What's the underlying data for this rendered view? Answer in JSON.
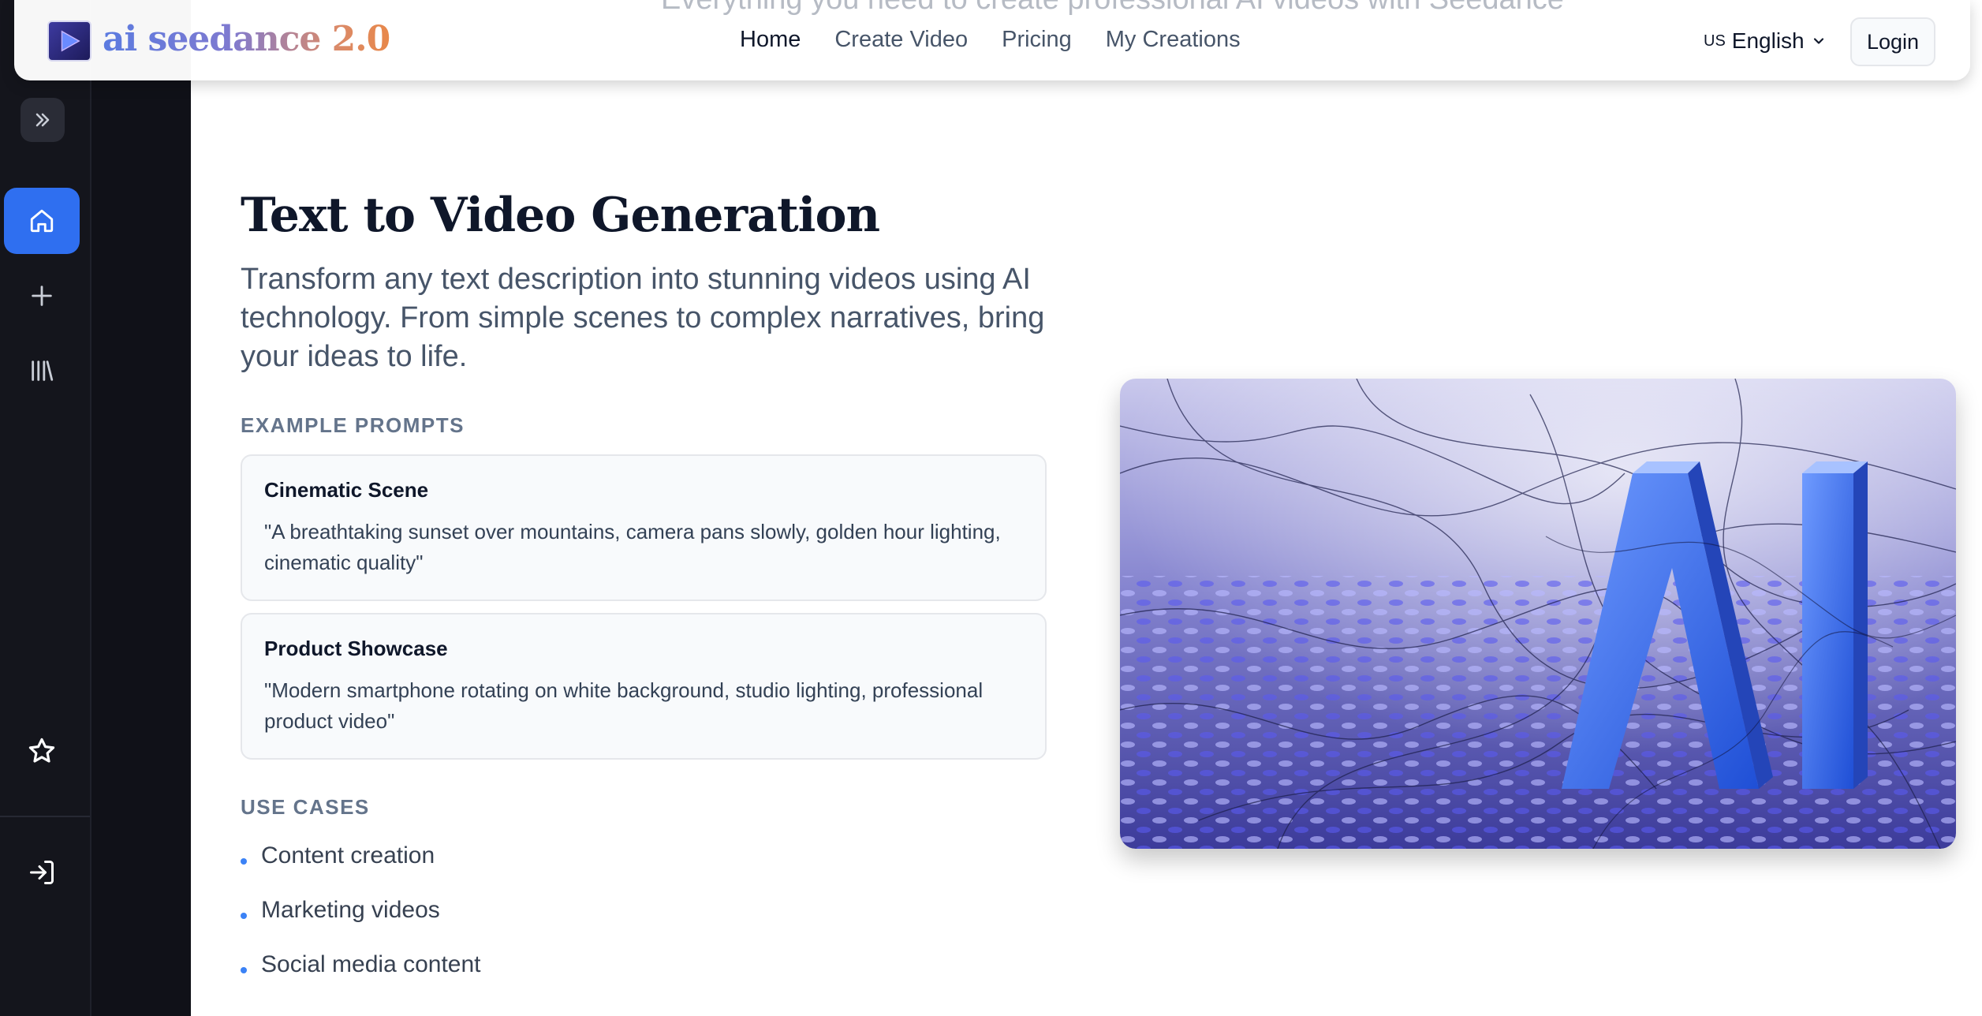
{
  "header": {
    "ghost_tagline": "Everything you need to create professional AI videos with Seedance",
    "logo_text": "ai seedance 2.0",
    "nav": [
      {
        "label": "Home",
        "active": true
      },
      {
        "label": "Create Video",
        "active": false
      },
      {
        "label": "Pricing",
        "active": false
      },
      {
        "label": "My Creations",
        "active": false
      }
    ],
    "language": {
      "flag": "US",
      "label": "English"
    },
    "login_label": "Login"
  },
  "sidebar": {
    "items": [
      {
        "icon": "chevrons-right-icon"
      },
      {
        "icon": "home-icon",
        "active": true
      },
      {
        "icon": "plus-icon"
      },
      {
        "icon": "library-icon"
      },
      {
        "icon": "star-icon"
      },
      {
        "icon": "sign-in-icon"
      }
    ]
  },
  "main": {
    "title": "Text to Video Generation",
    "description": "Transform any text description into stunning videos using AI technology. From simple scenes to complex narratives, bring your ideas to life.",
    "example_prompts_label": "EXAMPLE PROMPTS",
    "prompts": [
      {
        "title": "Cinematic Scene",
        "text": "\"A breathtaking sunset over mountains, camera pans slowly, golden hour lighting, cinematic quality\""
      },
      {
        "title": "Product Showcase",
        "text": "\"Modern smartphone rotating on white background, studio lighting, professional product video\""
      }
    ],
    "use_cases_label": "USE CASES",
    "use_cases": [
      "Content creation",
      "Marketing videos",
      "Social media content"
    ],
    "hero_image_text": "AI"
  },
  "colors": {
    "accent": "#2f6ff0",
    "sidebar_bg": "#14151c",
    "title": "#0f172a",
    "muted": "#64748b"
  }
}
